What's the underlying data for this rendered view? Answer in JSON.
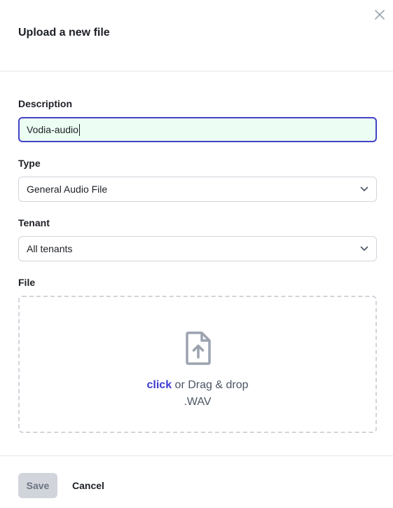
{
  "modal": {
    "title": "Upload a new file",
    "close_icon": "close-icon"
  },
  "form": {
    "description": {
      "label": "Description",
      "value": "Vodia-audio"
    },
    "type": {
      "label": "Type",
      "selected": "General Audio File",
      "icon": "chevron-down-icon"
    },
    "tenant": {
      "label": "Tenant",
      "selected": "All tenants",
      "icon": "chevron-down-icon"
    },
    "file": {
      "label": "File",
      "icon": "file-upload-icon",
      "link_text": "click",
      "drop_text": "or Drag & drop",
      "accepted_format": ".WAV"
    }
  },
  "footer": {
    "save_label": "Save",
    "cancel_label": "Cancel"
  },
  "colors": {
    "accent": "#3b3bd4",
    "input_focus_border": "#4343c8",
    "input_bg": "#ecfdf3",
    "disabled_button_bg": "#d1d5db"
  }
}
